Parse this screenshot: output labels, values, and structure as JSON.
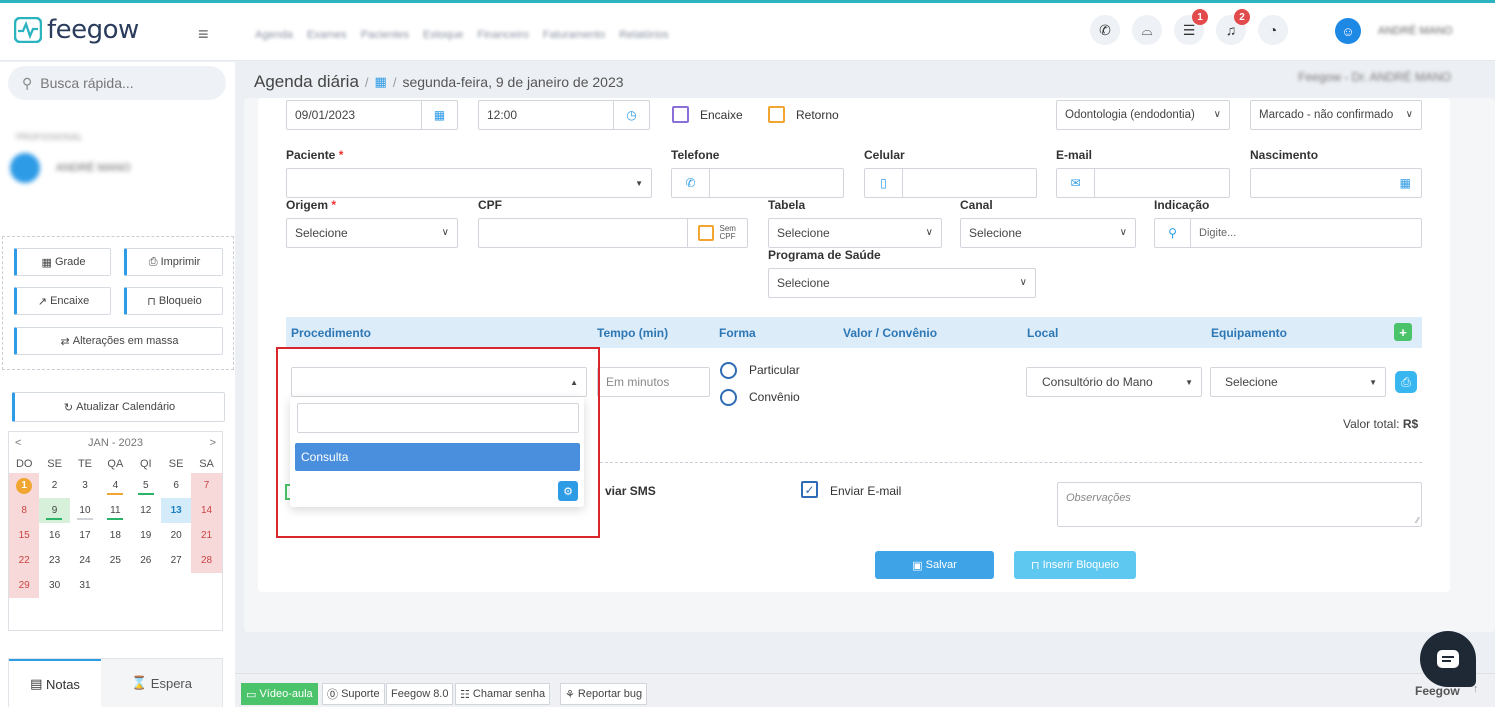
{
  "app": {
    "logo": "feegow"
  },
  "topbar": {
    "menu_blurred": [
      "Agenda",
      "Exames",
      "Pacientes",
      "Estoque",
      "Financeiro",
      "Faturamento",
      "Relatórios"
    ],
    "user_name": "ANDRÉ MANO",
    "badges": {
      "tasks": "1",
      "notifications": "2"
    }
  },
  "sidebar": {
    "search_placeholder": "Busca rápida...",
    "profile_label": "PROFISSIONAL",
    "profile_name": "ANDRÉ MANO",
    "buttons": {
      "grade": "Grade",
      "imprimir": "Imprimir",
      "encaixe": "Encaixe",
      "bloqueio": "Bloqueio",
      "alteracoes": "Alterações em massa",
      "atualizar": "Atualizar Calendário"
    },
    "calendar": {
      "month": "JAN - 2023",
      "prev": "<",
      "next": ">",
      "weekdays": [
        "DO",
        "SE",
        "TE",
        "QA",
        "QI",
        "SE",
        "SA"
      ],
      "weeks": [
        [
          "1",
          "2",
          "3",
          "4",
          "5",
          "6",
          "7"
        ],
        [
          "8",
          "9",
          "10",
          "11",
          "12",
          "13",
          "14"
        ],
        [
          "15",
          "16",
          "17",
          "18",
          "19",
          "20",
          "21"
        ],
        [
          "22",
          "23",
          "24",
          "25",
          "26",
          "27",
          "28"
        ],
        [
          "29",
          "30",
          "31",
          "",
          "",
          "",
          ""
        ]
      ]
    },
    "tabs": {
      "notas": "Notas",
      "espera": "Espera"
    }
  },
  "breadcrumb": {
    "title": "Agenda diária",
    "sep": "/",
    "date": "segunda-feira, 9 de janeiro de 2023",
    "doctor": "Feegow - Dr. ANDRÉ MANO"
  },
  "form": {
    "date": "09/01/2023",
    "time": "12:00",
    "encaixe": "Encaixe",
    "retorno": "Retorno",
    "especialidade": "Odontologia (endodontia)",
    "status": "Marcado - não confirmado",
    "labels": {
      "paciente": "Paciente",
      "telefone": "Telefone",
      "celular": "Celular",
      "email": "E-mail",
      "nascimento": "Nascimento",
      "origem": "Origem",
      "cpf": "CPF",
      "tabela": "Tabela",
      "canal": "Canal",
      "indicacao": "Indicação",
      "programa": "Programa de Saúde"
    },
    "required_mark": "*",
    "origem_value": "Selecione",
    "tabela_value": "Selecione",
    "canal_value": "Selecione",
    "programa_value": "Selecione",
    "indicacao_placeholder": "Digite...",
    "sem_cpf": "Sem CPF"
  },
  "procedures": {
    "headers": {
      "procedimento": "Procedimento",
      "tempo": "Tempo (min)",
      "forma": "Forma",
      "valor": "Valor / Convênio",
      "local": "Local",
      "equipamento": "Equipamento"
    },
    "add_label": "+",
    "tempo_placeholder": "Em minutos",
    "particular": "Particular",
    "convenio": "Convênio",
    "local_value": "Consultório do Mano",
    "equip_value": "Selecione",
    "valor_total_label": "Valor total:",
    "valor_total_value": "R$",
    "dropdown_option": "Consulta"
  },
  "notify": {
    "sms": "Enviar SMS",
    "email": "Enviar E-mail",
    "obs_placeholder": "Observações"
  },
  "actions": {
    "salvar": "Salvar",
    "bloqueio": "Inserir Bloqueio"
  },
  "footer": {
    "video": "Vídeo-aula",
    "suporte": "Suporte",
    "version": "Feegow 8.0",
    "chamar": "Chamar senha",
    "reportar": "Reportar bug",
    "brand": "Feegow"
  },
  "colors": {
    "accent": "#2e9be6",
    "primary_btn": "#3fa3e8",
    "bloqueio_btn": "#5ec8f0",
    "weekend": "#f7d9d9",
    "green": "#4bc36a",
    "red": "#d9262c"
  }
}
